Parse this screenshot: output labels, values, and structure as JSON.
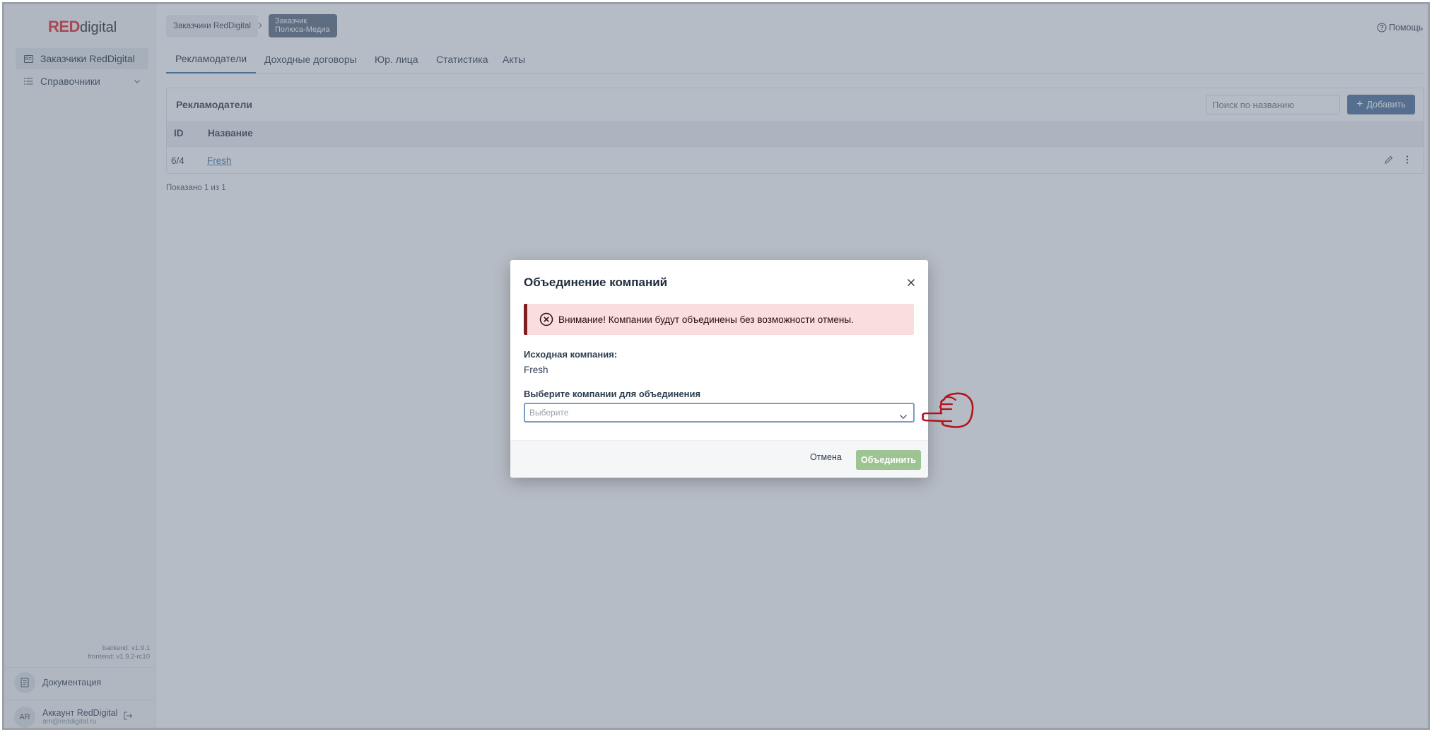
{
  "sidebar": {
    "logo_red": "RED",
    "logo_rest": "digital",
    "items": [
      {
        "label": "Заказчики RedDigital",
        "icon": "id-card-icon",
        "active": true
      },
      {
        "label": "Справочники",
        "icon": "list-icon",
        "expandable": true
      }
    ],
    "versions": {
      "backend": "backend: v1.9.1",
      "frontend": "frontend: v1.9.2-rc10"
    },
    "docs_label": "Документация",
    "account": {
      "initials": "AR",
      "name": "Аккаунт RedDigital",
      "email": "am@reddigital.ru"
    }
  },
  "breadcrumb": {
    "items": [
      "Заказчики RedDigital"
    ],
    "current_label": "Заказчик",
    "current_value": "Полюса-Медиа"
  },
  "help_label": "Помощь",
  "tabs": [
    {
      "label": "Рекламодатели",
      "active": true
    },
    {
      "label": "Доходные договоры"
    },
    {
      "label": "Юр. лица"
    },
    {
      "label": "Статистика"
    },
    {
      "label": "Акты"
    }
  ],
  "panel": {
    "title": "Рекламодатели",
    "search_placeholder": "Поиск по названию",
    "add_label": "Добавить",
    "columns": [
      "ID",
      "Название"
    ],
    "rows": [
      {
        "id": "6/4",
        "name": "Fresh"
      }
    ],
    "shown_text": "Показано 1 из 1"
  },
  "modal": {
    "title": "Объединение компаний",
    "alert_text": "Внимание! Компании будут объединены без возможности отмены.",
    "source_label": "Исходная компания:",
    "source_value": "Fresh",
    "select_label": "Выберите компании для объединения",
    "select_placeholder": "Выберите",
    "cancel_label": "Отмена",
    "merge_label": "Объединить"
  },
  "colors": {
    "brand_red": "#e0262d",
    "primary": "#4a6e9b",
    "alert_bg": "#f9dede",
    "alert_border": "#7d1f1f",
    "merge_disabled": "#9ec493",
    "overlay": "#647084"
  }
}
